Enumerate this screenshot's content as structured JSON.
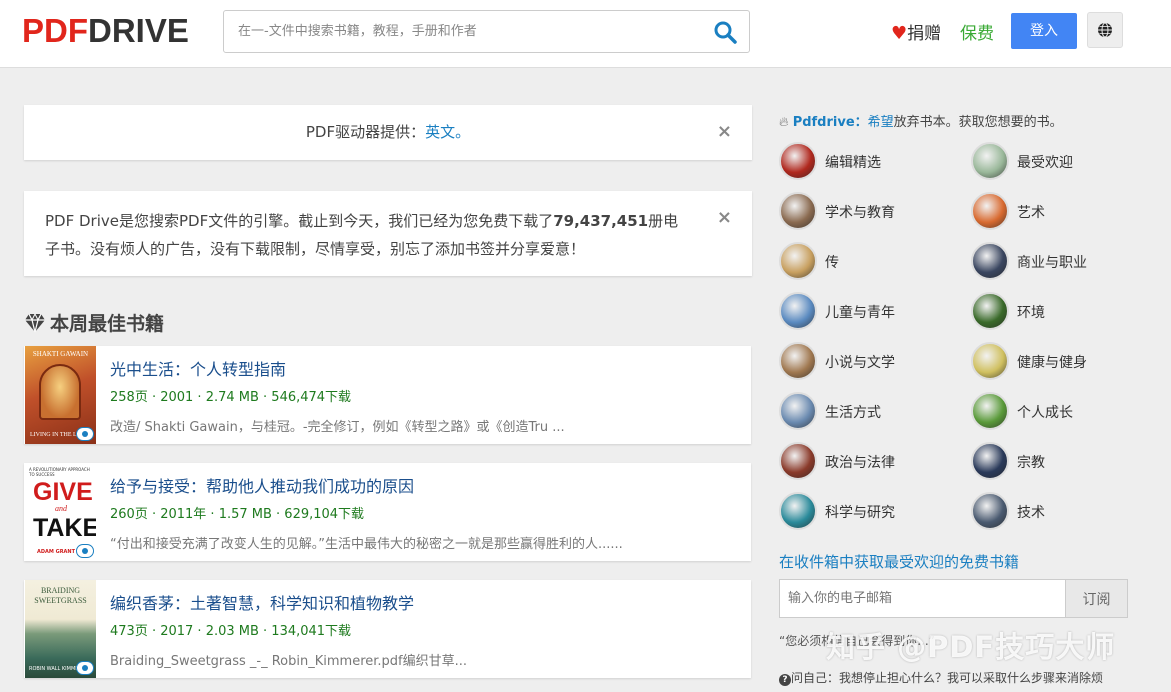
{
  "header": {
    "logo_pdf": "PDF",
    "logo_drive": "DRIVE",
    "search_placeholder": "在一-文件中搜索书籍，教程，手册和作者",
    "donate_label": "捐赠",
    "premium_label": "保费",
    "login_label": "登入"
  },
  "notice1": {
    "text": "PDF驱动器提供：",
    "link": "英文。",
    "close": "×"
  },
  "notice2": {
    "text_before": "PDF Drive是您搜索PDF文件的引擎。截止到今天，我们已经为您免费下载了",
    "count": "79,437,451",
    "text_after": "册电子书。没有烦人的广告，没有下载限制，尽情享受，别忘了添加书签并分享爱意！",
    "close": "×"
  },
  "section_title": "本周最佳书籍",
  "books": [
    {
      "title": "光中生活：个人转型指南",
      "meta": "258页 · 2001 · 2.74 MB · 546,474下载",
      "desc": "改造/ Shakti Gawain，与桂冠。-完全修订，例如《转型之路》或《创造Tru ...",
      "cover_top": "SHAKTI GAWAIN",
      "cover_bottom": "LIVING IN THE LIGHT"
    },
    {
      "title": "给予与接受：帮助他人推动我们成功的原因",
      "meta": "260页 · 2011年 · 1.57 MB · 629,104下载",
      "desc": "“付出和接受充满了改变人生的见解。”生活中最伟大的秘密之一就是那些赢得胜利的人......",
      "cover_top": "A REVOLUTIONARY APPROACH TO SUCCESS",
      "cover_give": "GIVE",
      "cover_and": "and",
      "cover_take": "TAKE.",
      "cover_author": "ADAM GRANT"
    },
    {
      "title": "编织香茅：土著智慧，科学知识和植物教学",
      "meta": "473页 · 2017 · 2.03 MB · 134,041下载",
      "desc": "Braiding_Sweetgrass _-_ Robin_Kimmerer.pdf编织甘草...",
      "cover_top1": "BRAIDING",
      "cover_top2": "SWEETGRASS",
      "cover_author": "ROBIN WALL KIMMERER"
    }
  ],
  "sidebar": {
    "intro_brand": "Pdfdrive：",
    "intro_hope": "希望",
    "intro_rest": "放弃书本。获取您想要的书。",
    "categories": [
      {
        "label": "编辑精选",
        "color": "#b0281e"
      },
      {
        "label": "最受欢迎",
        "color": "#9ab89a"
      },
      {
        "label": "学术与教育",
        "color": "#8a6a50"
      },
      {
        "label": "艺术",
        "color": "#d86a30"
      },
      {
        "label": "传",
        "color": "#c8a060"
      },
      {
        "label": "商业与职业",
        "color": "#3a4660"
      },
      {
        "label": "儿童与青年",
        "color": "#5a8ac0"
      },
      {
        "label": "环境",
        "color": "#3a6a2a"
      },
      {
        "label": "小说与文学",
        "color": "#a07850"
      },
      {
        "label": "健康与健身",
        "color": "#d0c060"
      },
      {
        "label": "生活方式",
        "color": "#6a8ab0"
      },
      {
        "label": "个人成长",
        "color": "#5a9a3a"
      },
      {
        "label": "政治与法律",
        "color": "#8a3a2a"
      },
      {
        "label": "宗教",
        "color": "#2a3a5a"
      },
      {
        "label": "科学与研究",
        "color": "#2a8a9a"
      },
      {
        "label": "技术",
        "color": "#4a5a70"
      }
    ],
    "newsletter_title": "在收件箱中获取最受欢迎的免费书籍",
    "email_placeholder": "输入你的电子邮箱",
    "subscribe_label": "订阅",
    "quote": "“您必须相信自己会得到你...”",
    "ask": "问自己：我想停止担心什么？我可以采取什么步骤来消除烦",
    "watermark": "知乎 @PDF技巧大师"
  }
}
